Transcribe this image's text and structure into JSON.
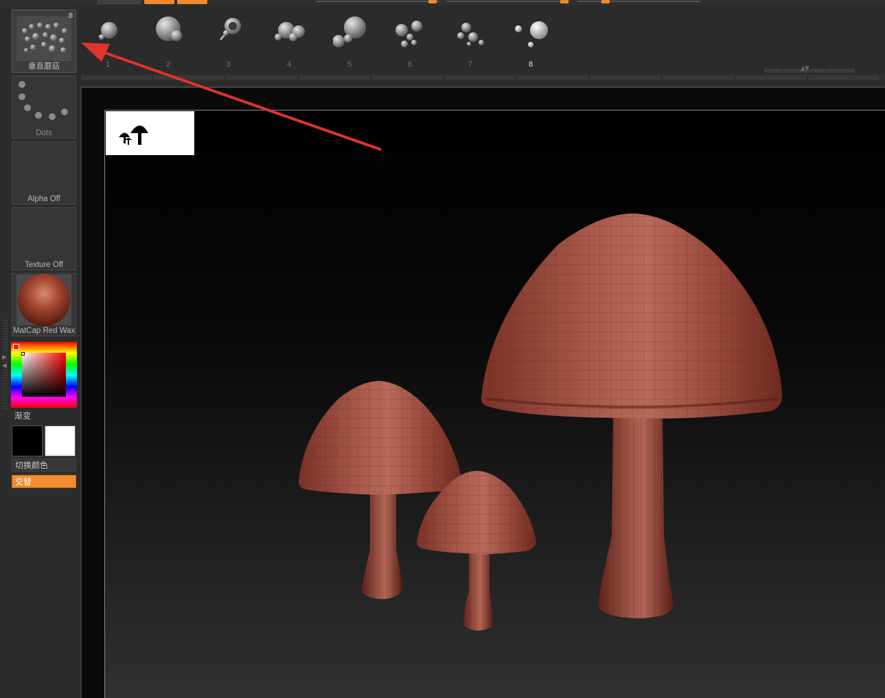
{
  "brush_tray": {
    "current_brush": {
      "label": "垂直蘑菇",
      "count": "8"
    },
    "stroke": {
      "label": "Dots"
    },
    "alpha": {
      "label": "Alpha Off"
    },
    "texture": {
      "label": "Texture Off"
    },
    "material": {
      "label": "MatCap Red Wax"
    }
  },
  "color": {
    "gradient_label": "渐变",
    "main_color": "#000000",
    "secondary_color": "#ffffff",
    "switch_color_label": "切换颜色",
    "alternate_label": "交替",
    "accent": "#f48b2e"
  },
  "brush_bar": {
    "items": [
      {
        "number": "1"
      },
      {
        "number": "2"
      },
      {
        "number": "3"
      },
      {
        "number": "4"
      },
      {
        "number": "5"
      },
      {
        "number": "6"
      },
      {
        "number": "7"
      },
      {
        "number": "8",
        "selected": true
      }
    ]
  },
  "icons": {
    "navigator": "mushroom-silhouette-icon",
    "annotation": "red-arrow-pointer"
  }
}
